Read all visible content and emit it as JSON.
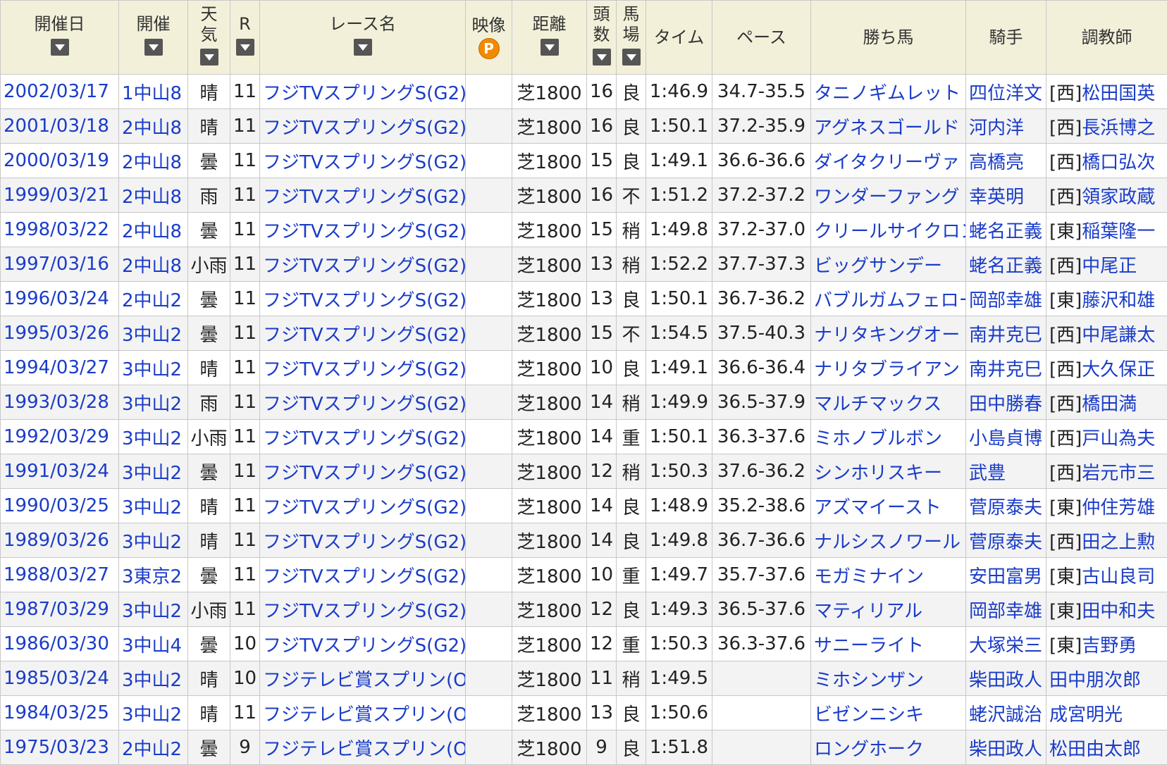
{
  "columns": [
    {
      "label": "開催日",
      "sort": true
    },
    {
      "label": "開催",
      "sort": true
    },
    {
      "label": "天\n気",
      "sort": true
    },
    {
      "label": "R",
      "sort": true
    },
    {
      "label": "レース名",
      "sort": true
    },
    {
      "label": "映像",
      "sort": false
    },
    {
      "label": "距離",
      "sort": true
    },
    {
      "label": "頭\n数",
      "sort": true
    },
    {
      "label": "馬\n場",
      "sort": true
    },
    {
      "label": "タイム",
      "sort": false
    },
    {
      "label": "ペース",
      "sort": false
    },
    {
      "label": "勝ち馬",
      "sort": false
    },
    {
      "label": "騎手",
      "sort": false
    },
    {
      "label": "調教師",
      "sort": false
    }
  ],
  "video_icon": {
    "glyph": "P",
    "color": "#f28a00"
  },
  "rows": [
    {
      "date": "2002/03/17",
      "kaisai": "1中山8",
      "weather": "晴",
      "r": "11",
      "race": "フジTVスプリングS(G2)",
      "dist": "芝1800",
      "heads": "16",
      "track": "良",
      "time": "1:46.9",
      "pace": "34.7-35.5",
      "horse": "タニノギムレット",
      "jockey": "四位洋文",
      "area": "[西]",
      "trainer": "松田国英"
    },
    {
      "date": "2001/03/18",
      "kaisai": "2中山8",
      "weather": "晴",
      "r": "11",
      "race": "フジTVスプリングS(G2)",
      "dist": "芝1800",
      "heads": "16",
      "track": "良",
      "time": "1:50.1",
      "pace": "37.2-35.9",
      "horse": "アグネスゴールド",
      "jockey": "河内洋",
      "area": "[西]",
      "trainer": "長浜博之"
    },
    {
      "date": "2000/03/19",
      "kaisai": "2中山8",
      "weather": "曇",
      "r": "11",
      "race": "フジTVスプリングS(G2)",
      "dist": "芝1800",
      "heads": "15",
      "track": "良",
      "time": "1:49.1",
      "pace": "36.6-36.6",
      "horse": "ダイタクリーヴァ",
      "jockey": "高橋亮",
      "area": "[西]",
      "trainer": "橋口弘次"
    },
    {
      "date": "1999/03/21",
      "kaisai": "2中山8",
      "weather": "雨",
      "r": "11",
      "race": "フジTVスプリングS(G2)",
      "dist": "芝1800",
      "heads": "16",
      "track": "不",
      "time": "1:51.2",
      "pace": "37.2-37.2",
      "horse": "ワンダーファング",
      "jockey": "幸英明",
      "area": "[西]",
      "trainer": "領家政蔵"
    },
    {
      "date": "1998/03/22",
      "kaisai": "2中山8",
      "weather": "曇",
      "r": "11",
      "race": "フジTVスプリングS(G2)",
      "dist": "芝1800",
      "heads": "15",
      "track": "稍",
      "time": "1:49.8",
      "pace": "37.2-37.0",
      "horse": "クリールサイクロン",
      "jockey": "蛯名正義",
      "area": "[東]",
      "trainer": "稲葉隆一"
    },
    {
      "date": "1997/03/16",
      "kaisai": "2中山8",
      "weather": "小雨",
      "r": "11",
      "race": "フジTVスプリングS(G2)",
      "dist": "芝1800",
      "heads": "13",
      "track": "稍",
      "time": "1:52.2",
      "pace": "37.7-37.3",
      "horse": "ビッグサンデー",
      "jockey": "蛯名正義",
      "area": "[西]",
      "trainer": "中尾正"
    },
    {
      "date": "1996/03/24",
      "kaisai": "2中山2",
      "weather": "曇",
      "r": "11",
      "race": "フジTVスプリングS(G2)",
      "dist": "芝1800",
      "heads": "13",
      "track": "良",
      "time": "1:50.1",
      "pace": "36.7-36.2",
      "horse": "バブルガムフェロー",
      "jockey": "岡部幸雄",
      "area": "[東]",
      "trainer": "藤沢和雄"
    },
    {
      "date": "1995/03/26",
      "kaisai": "3中山2",
      "weather": "曇",
      "r": "11",
      "race": "フジTVスプリングS(G2)",
      "dist": "芝1800",
      "heads": "15",
      "track": "不",
      "time": "1:54.5",
      "pace": "37.5-40.3",
      "horse": "ナリタキングオー",
      "jockey": "南井克巳",
      "area": "[西]",
      "trainer": "中尾謙太"
    },
    {
      "date": "1994/03/27",
      "kaisai": "3中山2",
      "weather": "晴",
      "r": "11",
      "race": "フジTVスプリングS(G2)",
      "dist": "芝1800",
      "heads": "10",
      "track": "良",
      "time": "1:49.1",
      "pace": "36.6-36.4",
      "horse": "ナリタブライアン",
      "jockey": "南井克巳",
      "area": "[西]",
      "trainer": "大久保正"
    },
    {
      "date": "1993/03/28",
      "kaisai": "3中山2",
      "weather": "雨",
      "r": "11",
      "race": "フジTVスプリングS(G2)",
      "dist": "芝1800",
      "heads": "14",
      "track": "稍",
      "time": "1:49.9",
      "pace": "36.5-37.9",
      "horse": "マルチマックス",
      "jockey": "田中勝春",
      "area": "[西]",
      "trainer": "橋田満"
    },
    {
      "date": "1992/03/29",
      "kaisai": "3中山2",
      "weather": "小雨",
      "r": "11",
      "race": "フジTVスプリングS(G2)",
      "dist": "芝1800",
      "heads": "14",
      "track": "重",
      "time": "1:50.1",
      "pace": "36.3-37.6",
      "horse": "ミホノブルボン",
      "jockey": "小島貞博",
      "area": "[西]",
      "trainer": "戸山為夫"
    },
    {
      "date": "1991/03/24",
      "kaisai": "3中山2",
      "weather": "曇",
      "r": "11",
      "race": "フジTVスプリングS(G2)",
      "dist": "芝1800",
      "heads": "12",
      "track": "稍",
      "time": "1:50.3",
      "pace": "37.6-36.2",
      "horse": "シンホリスキー",
      "jockey": "武豊",
      "area": "[西]",
      "trainer": "岩元市三"
    },
    {
      "date": "1990/03/25",
      "kaisai": "3中山2",
      "weather": "晴",
      "r": "11",
      "race": "フジTVスプリングS(G2)",
      "dist": "芝1800",
      "heads": "14",
      "track": "良",
      "time": "1:48.9",
      "pace": "35.2-38.6",
      "horse": "アズマイースト",
      "jockey": "菅原泰夫",
      "area": "[東]",
      "trainer": "仲住芳雄"
    },
    {
      "date": "1989/03/26",
      "kaisai": "3中山2",
      "weather": "晴",
      "r": "11",
      "race": "フジTVスプリングS(G2)",
      "dist": "芝1800",
      "heads": "14",
      "track": "良",
      "time": "1:49.8",
      "pace": "36.7-36.6",
      "horse": "ナルシスノワール",
      "jockey": "菅原泰夫",
      "area": "[西]",
      "trainer": "田之上勲"
    },
    {
      "date": "1988/03/27",
      "kaisai": "3東京2",
      "weather": "曇",
      "r": "11",
      "race": "フジTVスプリングS(G2)",
      "dist": "芝1800",
      "heads": "10",
      "track": "重",
      "time": "1:49.7",
      "pace": "35.7-37.6",
      "horse": "モガミナイン",
      "jockey": "安田富男",
      "area": "[東]",
      "trainer": "古山良司"
    },
    {
      "date": "1987/03/29",
      "kaisai": "3中山2",
      "weather": "小雨",
      "r": "11",
      "race": "フジTVスプリングS(G2)",
      "dist": "芝1800",
      "heads": "12",
      "track": "良",
      "time": "1:49.3",
      "pace": "36.5-37.6",
      "horse": "マティリアル",
      "jockey": "岡部幸雄",
      "area": "[東]",
      "trainer": "田中和夫"
    },
    {
      "date": "1986/03/30",
      "kaisai": "3中山4",
      "weather": "曇",
      "r": "10",
      "race": "フジTVスプリングS(G2)",
      "dist": "芝1800",
      "heads": "12",
      "track": "重",
      "time": "1:50.3",
      "pace": "36.3-37.6",
      "horse": "サニーライト",
      "jockey": "大塚栄三",
      "area": "[東]",
      "trainer": "吉野勇"
    },
    {
      "date": "1985/03/24",
      "kaisai": "3中山2",
      "weather": "晴",
      "r": "10",
      "race": "フジテレビ賞スプリン(OP)",
      "dist": "芝1800",
      "heads": "11",
      "track": "稍",
      "time": "1:49.5",
      "pace": "",
      "horse": "ミホシンザン",
      "jockey": "柴田政人",
      "area": "",
      "trainer": "田中朋次郎"
    },
    {
      "date": "1984/03/25",
      "kaisai": "3中山2",
      "weather": "晴",
      "r": "11",
      "race": "フジテレビ賞スプリン(OP)",
      "dist": "芝1800",
      "heads": "13",
      "track": "良",
      "time": "1:50.6",
      "pace": "",
      "horse": "ビゼンニシキ",
      "jockey": "蛯沢誠治",
      "area": "",
      "trainer": "成宮明光"
    },
    {
      "date": "1975/03/23",
      "kaisai": "2中山2",
      "weather": "曇",
      "r": "9",
      "race": "フジテレビ賞スプリン(OP)",
      "dist": "芝1800",
      "heads": "9",
      "track": "良",
      "time": "1:51.8",
      "pace": "",
      "horse": "ロングホーク",
      "jockey": "柴田政人",
      "area": "",
      "trainer": "松田由太郎"
    }
  ]
}
